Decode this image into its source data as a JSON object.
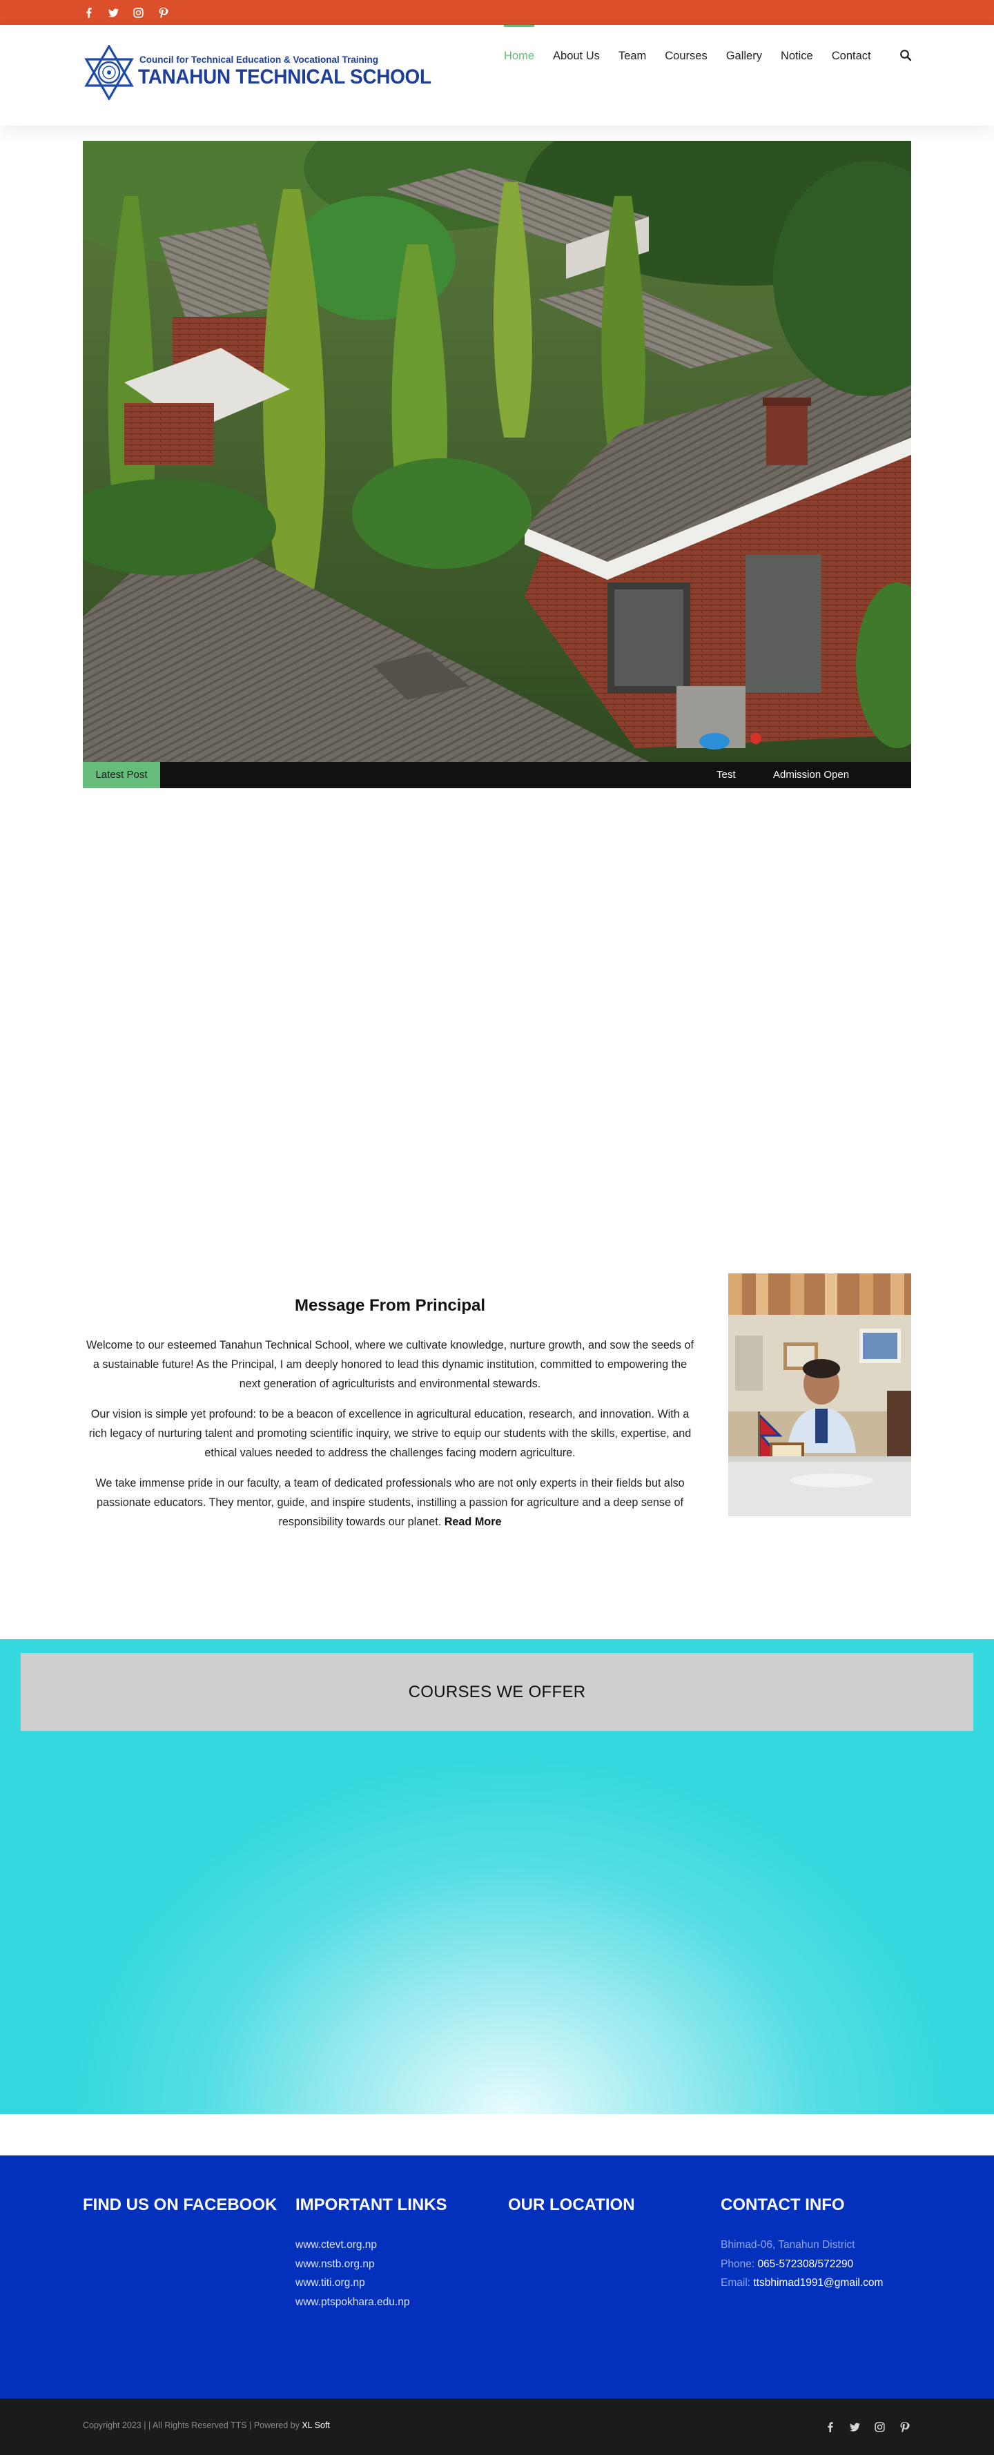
{
  "top_bar": {
    "social": [
      "facebook-icon",
      "twitter-icon",
      "instagram-icon",
      "pinterest-icon"
    ],
    "bg_color": "#db4f2b"
  },
  "header": {
    "logo": {
      "line1": "Council for Technical Education & Vocational Training",
      "line2": "TANAHUN TECHNICAL SCHOOL"
    },
    "nav": [
      {
        "label": "Home",
        "active": true
      },
      {
        "label": "About Us",
        "active": false
      },
      {
        "label": "Team",
        "active": false
      },
      {
        "label": "Courses",
        "active": false
      },
      {
        "label": "Gallery",
        "active": false
      },
      {
        "label": "Notice",
        "active": false
      },
      {
        "label": "Contact",
        "active": false
      }
    ],
    "search_icon": "search-icon",
    "accent_color": "#65bc7b"
  },
  "ticker": {
    "label": "Latest Post",
    "items": [
      "Test",
      "Admission Open"
    ]
  },
  "principal": {
    "title": "Message From Principal",
    "paragraphs": [
      "Welcome to our esteemed Tanahun Technical School, where we cultivate knowledge, nurture growth, and sow the seeds of a sustainable future! As the Principal, I am deeply honored to lead this dynamic institution, committed to empowering the next generation of agriculturists and environmental stewards.",
      "Our vision is simple yet profound: to be a beacon of excellence in agricultural education, research, and innovation. With a rich legacy of nurturing talent and promoting scientific inquiry, we strive to equip our students with the skills, expertise, and ethical values needed to address the challenges facing modern agriculture.",
      "We take immense pride in our faculty, a team of dedicated professionals who are not only experts in their fields but also passionate educators. They mentor, guide, and inspire students, instilling a passion for agriculture and a deep sense of responsibility towards our planet."
    ],
    "read_more": "Read More"
  },
  "courses": {
    "title": "COURSES WE OFFER"
  },
  "footer": {
    "facebook_title": "FIND US ON FACEBOOK",
    "links_title": "IMPORTANT LINKS",
    "links": [
      "www.ctevt.org.np",
      "www.nstb.org.np",
      "www.titi.org.np",
      "www.ptspokhara.edu.np"
    ],
    "location_title": "OUR LOCATION",
    "contact_title": "CONTACT INFO",
    "contact": {
      "address": "Bhimad-06, Tanahun District",
      "phone_label": "Phone: ",
      "phone": "065-572308/572290",
      "email_label": "Email: ",
      "email": "ttsbhimad1991@gmail.com"
    },
    "bg_color": "#0431bc"
  },
  "bottom_bar": {
    "copyright": "Copyright 2023 | | All Rights Reserved TTS | Powered by ",
    "powered_by": "XL Soft",
    "social": [
      "facebook-icon",
      "twitter-icon",
      "instagram-icon",
      "pinterest-icon"
    ]
  }
}
